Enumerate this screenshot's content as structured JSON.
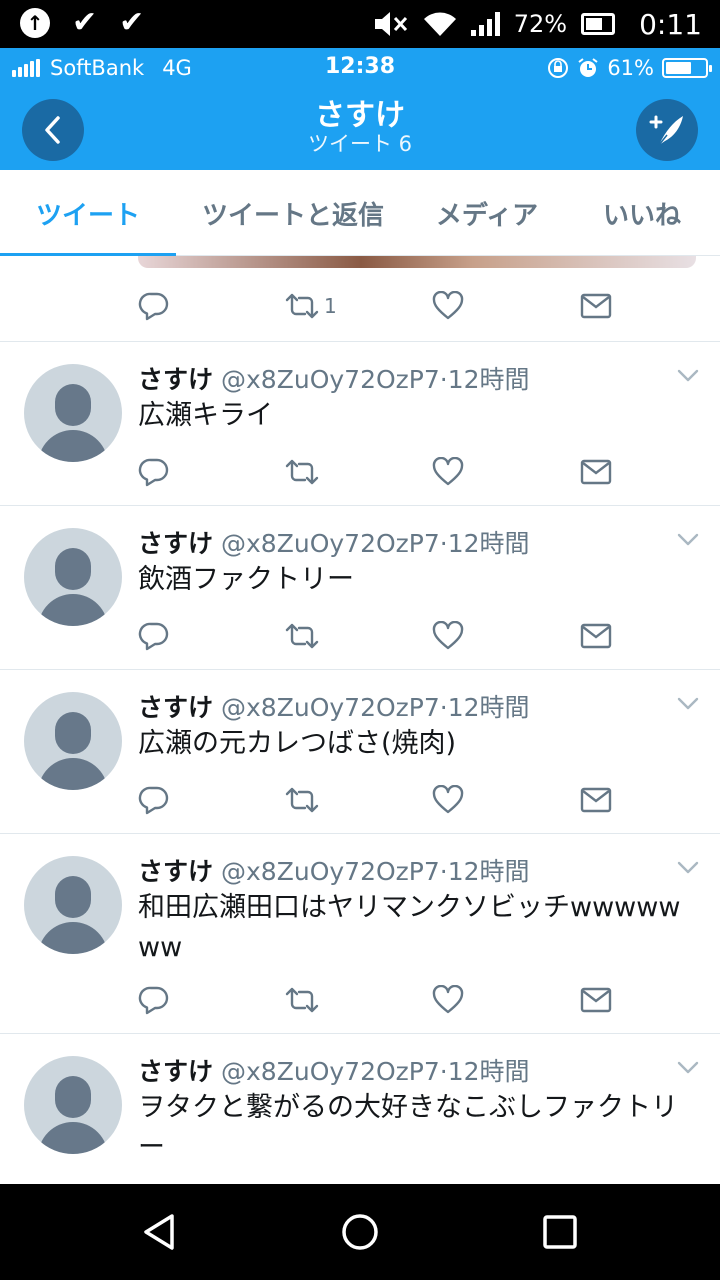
{
  "system_bar": {
    "battery": "72%",
    "time": "0:11"
  },
  "ios_bar": {
    "carrier": "SoftBank",
    "network": "4G",
    "time": "12:38",
    "battery": "61%"
  },
  "header": {
    "title": "さすけ",
    "subtitle": "ツイート 6"
  },
  "tabs": [
    {
      "label": "ツイート"
    },
    {
      "label": "ツイートと返信"
    },
    {
      "label": "メディア"
    },
    {
      "label": "いいね"
    }
  ],
  "first_actions": {
    "retweet_count": "1"
  },
  "tweets": [
    {
      "name": "さすけ",
      "handle": "@x8ZuOy72OzP7",
      "time": "·12時間",
      "text": "広瀬キライ"
    },
    {
      "name": "さすけ",
      "handle": "@x8ZuOy72OzP7",
      "time": "·12時間",
      "text": "飲酒ファクトリー"
    },
    {
      "name": "さすけ",
      "handle": "@x8ZuOy72OzP7",
      "time": "·12時間",
      "text": "広瀬の元カレつばさ(焼肉)"
    },
    {
      "name": "さすけ",
      "handle": "@x8ZuOy72OzP7",
      "time": "·12時間",
      "text": "和田広瀬田口はヤリマンクソビッチwwwwwww"
    },
    {
      "name": "さすけ",
      "handle": "@x8ZuOy72OzP7",
      "time": "·12時間",
      "text": "ヲタクと繋がるの大好きなこぶしファクトリー"
    }
  ],
  "colors": {
    "brand": "#1da1f2",
    "icon_gray": "#657786",
    "divider": "#e1e8ed"
  }
}
